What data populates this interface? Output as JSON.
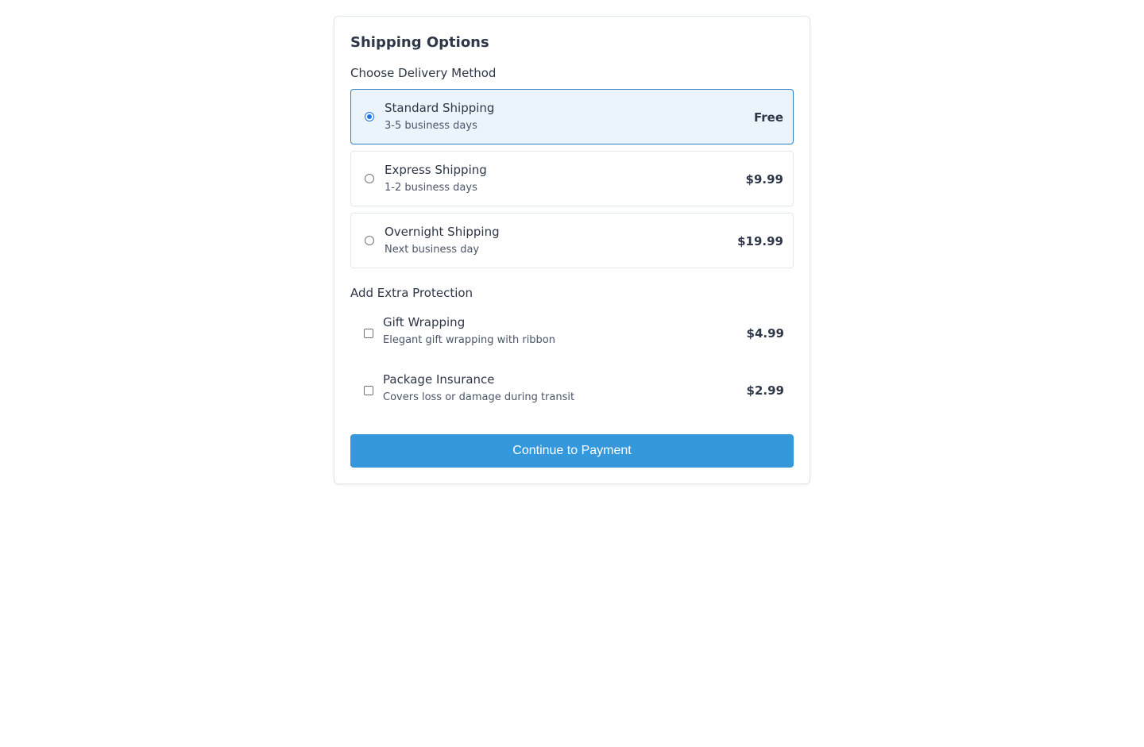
{
  "title": "Shipping Options",
  "delivery": {
    "label": "Choose Delivery Method",
    "options": [
      {
        "name": "Standard Shipping",
        "sub": "3-5 business days",
        "price": "Free",
        "selected": true
      },
      {
        "name": "Express Shipping",
        "sub": "1-2 business days",
        "price": "$9.99",
        "selected": false
      },
      {
        "name": "Overnight Shipping",
        "sub": "Next business day",
        "price": "$19.99",
        "selected": false
      }
    ]
  },
  "extras": {
    "label": "Add Extra Protection",
    "options": [
      {
        "name": "Gift Wrapping",
        "sub": "Elegant gift wrapping with ribbon",
        "price": "$4.99",
        "checked": false
      },
      {
        "name": "Package Insurance",
        "sub": "Covers loss or damage during transit",
        "price": "$2.99",
        "checked": false
      }
    ]
  },
  "button": {
    "label": "Continue to Payment"
  },
  "colors": {
    "accent": "#3498db",
    "selected_border": "#3182ce",
    "selected_bg": "#ebf4fb",
    "text": "#2d3748"
  }
}
